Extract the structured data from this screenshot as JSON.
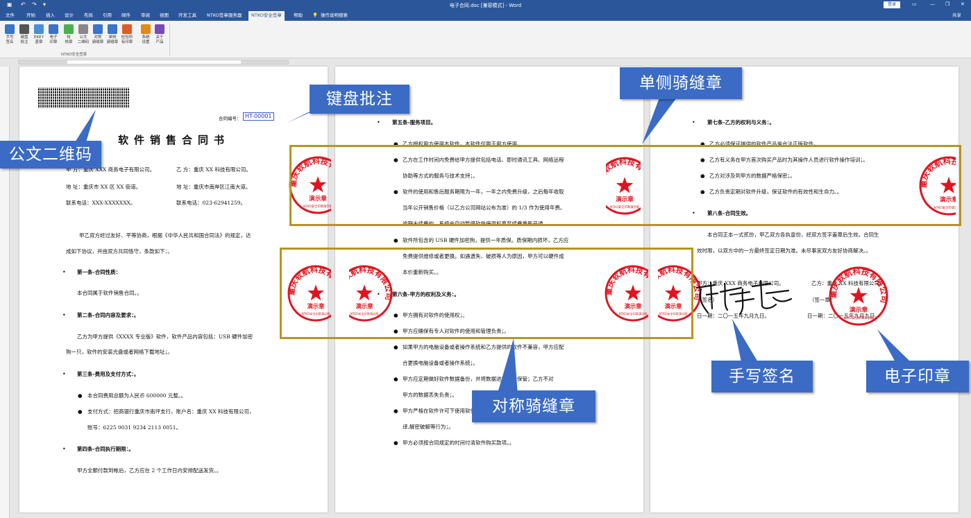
{
  "window": {
    "title": "电子合同.doc [兼容模式] - Word",
    "login_label": "登录",
    "share_label": "共享"
  },
  "tabs": [
    "文件",
    "开始",
    "插入",
    "设计",
    "布局",
    "引用",
    "邮件",
    "审阅",
    "视图",
    "开发工具",
    "NTKO签章服务器",
    "NTKO安全签章",
    "帮助",
    "操作说明搜索"
  ],
  "ribbon": {
    "buttons": [
      {
        "label1": "手写",
        "label2": "签名",
        "icon": "pen-icon",
        "color": "#3a73c8"
      },
      {
        "label1": "键盘",
        "label2": "批注",
        "icon": "keyboard-icon",
        "color": "#555"
      },
      {
        "label1": "EKEY",
        "label2": "盖章",
        "icon": "users-icon",
        "color": "#4a8fd6"
      },
      {
        "label1": "电子",
        "label2": "印章",
        "icon": "stamp-icon",
        "color": "#3a73c8"
      },
      {
        "label1": "校",
        "label2": "核章",
        "icon": "refresh-icon",
        "color": "#4caf50"
      },
      {
        "label1": "公文",
        "label2": "二维码",
        "icon": "barcode-icon",
        "color": "#888"
      },
      {
        "label1": "对称",
        "label2": "骑缝章",
        "icon": "symmetric-seal-icon",
        "color": "#3a73c8"
      },
      {
        "label1": "单侧",
        "label2": "骑缝章",
        "icon": "single-seal-icon",
        "color": "#3a73c8"
      },
      {
        "label1": "检验所",
        "label2": "有印章",
        "icon": "verify-icon",
        "color": "#e05a2a"
      },
      {
        "label1": "系统",
        "label2": "设置",
        "icon": "gear-icon",
        "color": "#e08a1a"
      },
      {
        "label1": "关于",
        "label2": "产品",
        "icon": "help-icon",
        "color": "#7a4ab8"
      }
    ],
    "group_label": "NTKO安全签章"
  },
  "page1": {
    "contract_no_label": "合同编号：",
    "contract_no": "HT-00001",
    "title": "软件销售合同书",
    "party_a": "甲  方：重庆 XXX 商务电子有限公司。",
    "party_b": "乙  方：重庆 XX 科技有限公司。",
    "addr_a": "地  址：重庆市 XX 区 XX 街道。",
    "addr_b": "地  址：重庆市南岸区江南大道。",
    "tel_a": "联系电话：XXX-XXXXXXX。",
    "tel_b": "联系电话：023-62941259。",
    "intro1": "甲乙双方经过友好、平等协商，根据《中华人民共和国合同法》的规定，达",
    "intro2": "成如下协议，并由双方共同恪守，条款如下：。",
    "s1": "第一条-合同性质：",
    "s1_body": "本合同属于软件销售合同。。",
    "s2": "第二条-合同内容及要求：。",
    "s2_body1": "乙方为甲方提供《XXXX 专业版》软件，软件产品内容包括：USB 硬件加密",
    "s2_body2": "狗一只，软件的安装光盘或者网络下载地址；。",
    "s3": "第三条-费用及支付方式：。",
    "s3_b1": "本合同费用总额为人民币 600000 元整。。",
    "s3_b2": "支付方式：招商银行重庆市南坪支行，账户名：重庆 XX 科技有限公司，",
    "s3_b3": "账号：6225 0031 9234 2113 0051。",
    "s4": "第四条-合同执行期限：。",
    "s4_body": "甲方全额付款到帐后，乙方应在 2 个工作日内安排配送发货。。"
  },
  "page2": {
    "s5": "第五条-服务项目。",
    "s5_b1": "乙方授权甲方使用本软件，本软件仅限于甲方使用。",
    "s5_b2a": "乙方在工作时间内免费给甲方提供包括电话、即时通讯工具、网络远程",
    "s5_b2b": "协助等方式的服务与技术支持；。",
    "s5_b3a": "软件的使用和售后服务期限为一年，一年之内免费升级，之后每年收取",
    "s5_b3b": "当年公开销售价格（以乙方公司网站公布为准）的 1/3 作为使用年费。",
    "s5_b3c": "逾期未续费的，系统会自动暂停软件使用权直至续费重新开通。",
    "s5_b4a": "软件所包含的 USB 硬件加密狗，提供一年质保。质保期内损坏，乙方应",
    "s5_b4b": "免费提供维修或者更换。如遇遗失、破损等人为原因，甲方可以硬件成",
    "s5_b4c": "本价重新购买。。",
    "s6": "第六条-甲方的权利及义务：。",
    "s6_b1": "甲方拥有对软件的使用权；。",
    "s6_b2": "甲方应确保有专人对软件的使用和管理负责；。",
    "s6_b3a": "如果甲方的电脑设备或者操作系统和乙方提供的软件不兼容，甲方应配",
    "s6_b3b": "合更换电脑设备或者操作系统；。",
    "s6_b4a": "甲方应定期做好软件数据备份，并将数据进行妥善保管；乙方不对",
    "s6_b4b": "甲方的数据丢失负责；。",
    "s6_b5a": "甲方严格在软件许可下使用软件，不得对软件进行反编译、反汇编、翻",
    "s6_b5b": "译,解密破解等行为；。",
    "s6_b6": "甲方必须按合同规定的时间付清软件购买款项。。"
  },
  "page3": {
    "s7": "第七条-乙方的权利与义务：。",
    "s7_b1": "乙方必须保证提供的软件产品是合法正版软件。",
    "s7_b2": "乙方有义务在甲方首次购买产品时为其操作人员进行软件操作培训；。",
    "s7_b3": "乙方对涉及到甲方的数据严格保密；。",
    "s7_b4": "乙方负责定期对软件升级，保证软件的有效性和生命力。。",
    "s8": "第八条-合同生效。",
    "s8_body1": "本合同正本一式贰份，甲乙双方各执壹份，经双方签字盖章后生效。合同生",
    "s8_body2": "效时限，以双方中的一方最终签定日期为准。未尽事宜双方友好协商解决。。",
    "sign_a": "甲方：重庆 XXX 商务电子有限公司。",
    "sign_b": "乙方：重庆 XX 科技有限公司。",
    "sign_a2": "（签名）",
    "sign_b2": "（签一章）",
    "date_a": "日一期：二〇一五年九月九日。",
    "date_b": "日一期：二〇一五年九月九日。"
  },
  "stamps": {
    "company": "重庆软航科技有限公司",
    "center": "演示章",
    "footer": "NTKO安全印章演示版"
  },
  "callouts": {
    "qr": "公文二维码",
    "keyboard": "键盘批注",
    "single": "单侧骑缝章",
    "symmetric": "对称骑缝章",
    "handwrite": "手写签名",
    "seal": "电子印章"
  },
  "colors": {
    "title_bar": "#2b579a",
    "callout": "#3b6bc4",
    "frame": "#b8941f",
    "stamp": "#e0141e"
  }
}
